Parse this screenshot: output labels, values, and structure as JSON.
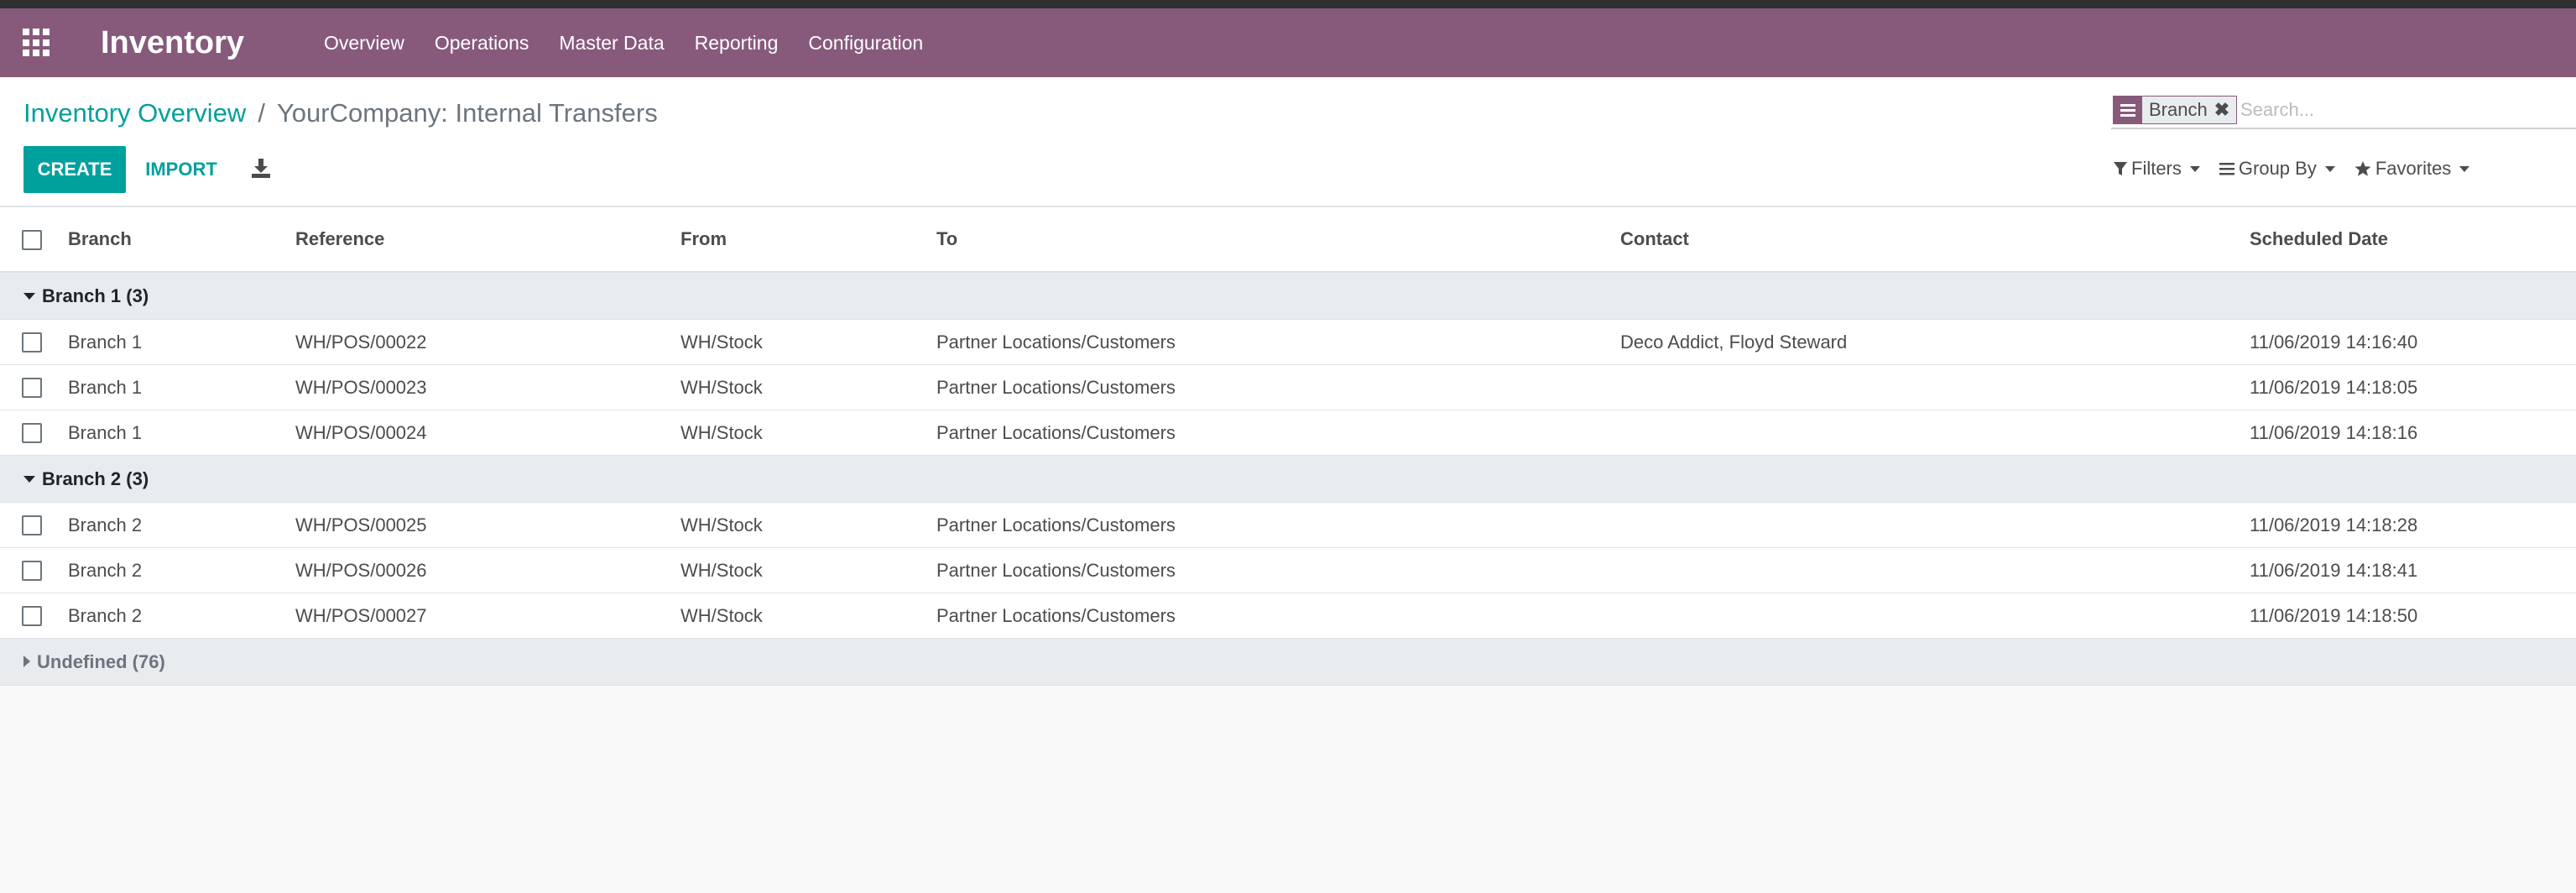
{
  "navbar": {
    "app_name": "Inventory",
    "menu": [
      "Overview",
      "Operations",
      "Master Data",
      "Reporting",
      "Configuration"
    ]
  },
  "breadcrumb": {
    "parent": "Inventory Overview",
    "separator": "/",
    "current": "YourCompany: Internal Transfers"
  },
  "toolbar": {
    "create_label": "CREATE",
    "import_label": "IMPORT"
  },
  "search": {
    "facet_label": "Branch",
    "placeholder": "Search...",
    "value": ""
  },
  "search_options": {
    "filters_label": "Filters",
    "groupby_label": "Group By",
    "favorites_label": "Favorites"
  },
  "table": {
    "columns": [
      "Branch",
      "Reference",
      "From",
      "To",
      "Contact",
      "Scheduled Date"
    ],
    "groups": [
      {
        "label": "Branch 1 (3)",
        "rows": [
          [
            "Branch 1",
            "WH/POS/00022",
            "WH/Stock",
            "Partner Locations/Customers",
            "Deco Addict, Floyd Steward",
            "11/06/2019 14:16:40"
          ],
          [
            "Branch 1",
            "WH/POS/00023",
            "WH/Stock",
            "Partner Locations/Customers",
            "",
            "11/06/2019 14:18:05"
          ],
          [
            "Branch 1",
            "WH/POS/00024",
            "WH/Stock",
            "Partner Locations/Customers",
            "",
            "11/06/2019 14:18:16"
          ]
        ]
      },
      {
        "label": "Branch 2 (3)",
        "rows": [
          [
            "Branch 2",
            "WH/POS/00025",
            "WH/Stock",
            "Partner Locations/Customers",
            "",
            "11/06/2019 14:18:28"
          ],
          [
            "Branch 2",
            "WH/POS/00026",
            "WH/Stock",
            "Partner Locations/Customers",
            "",
            "11/06/2019 14:18:41"
          ],
          [
            "Branch 2",
            "WH/POS/00027",
            "WH/Stock",
            "Partner Locations/Customers",
            "",
            "11/06/2019 14:18:50"
          ]
        ]
      }
    ],
    "collapsed_group": "Undefined (76)"
  },
  "colors": {
    "navbar": "#875a7b",
    "accent": "#00a09d",
    "group_bg": "#e9ecef"
  }
}
